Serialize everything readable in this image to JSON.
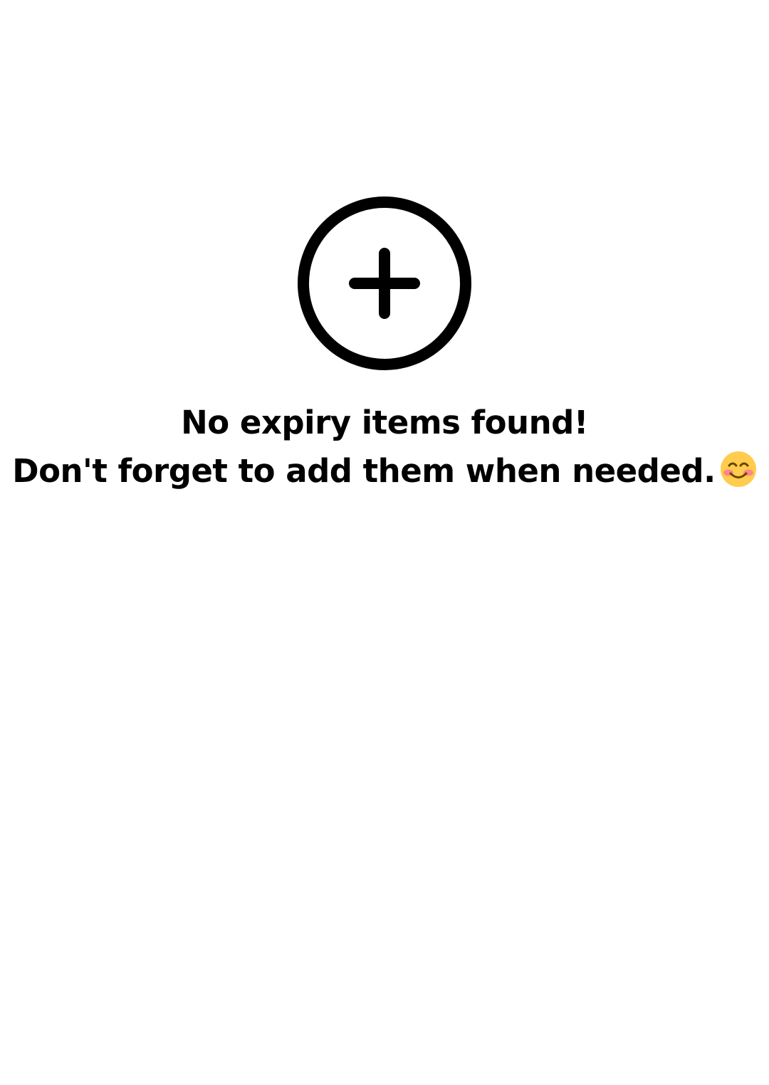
{
  "empty_state": {
    "add_icon": "plus-circle-icon",
    "line1": "No expiry items found!",
    "line2": "Don't forget to add them when needed.",
    "emoji_icon": "smiling-face-with-smiling-eyes-icon"
  },
  "colors": {
    "background": "#ffffff",
    "text": "#000000",
    "icon_stroke": "#000000",
    "emoji_face": "#FFCC4D",
    "emoji_blush": "#FF7892"
  }
}
